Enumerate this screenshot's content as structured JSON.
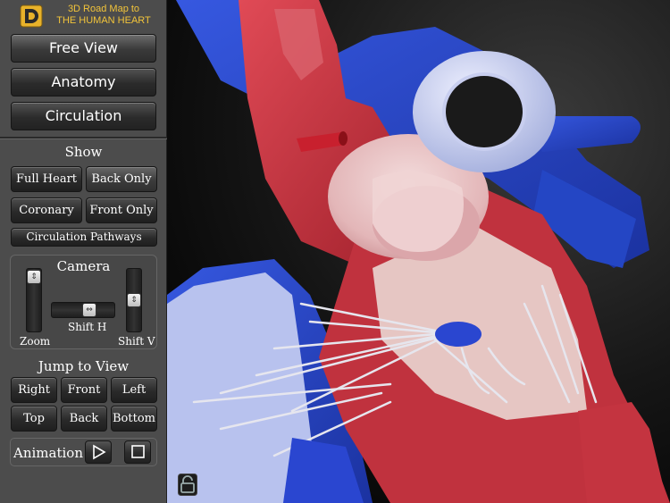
{
  "app": {
    "title_line1": "3D Road Map to",
    "title_line2": "THE HUMAN HEART"
  },
  "modes": [
    {
      "label": "Free View",
      "active": true
    },
    {
      "label": "Anatomy",
      "active": false
    },
    {
      "label": "Circulation",
      "active": false
    }
  ],
  "show": {
    "title": "Show",
    "full_heart": "Full Heart",
    "back_only": "Back Only",
    "coronary": "Coronary",
    "front_only": "Front Only",
    "circulation_pathways": "Circulation Pathways"
  },
  "camera": {
    "title": "Camera",
    "zoom_label": "Zoom",
    "shift_h_label": "Shift H",
    "shift_v_label": "Shift V"
  },
  "jump": {
    "title": "Jump to View",
    "right": "Right",
    "front": "Front",
    "left": "Left",
    "top": "Top",
    "back": "Back",
    "bottom": "Bottom"
  },
  "animation": {
    "label": "Animation"
  },
  "icons": {
    "logo": "app-logo-icon",
    "play": "play-icon",
    "stop": "stop-icon",
    "lock": "unlocked-padlock-icon"
  },
  "colors": {
    "title_gold": "#f2c43a",
    "panel": "#4c4c4c",
    "vein_blue": "#2d4fd0",
    "artery_red": "#c8303c"
  }
}
